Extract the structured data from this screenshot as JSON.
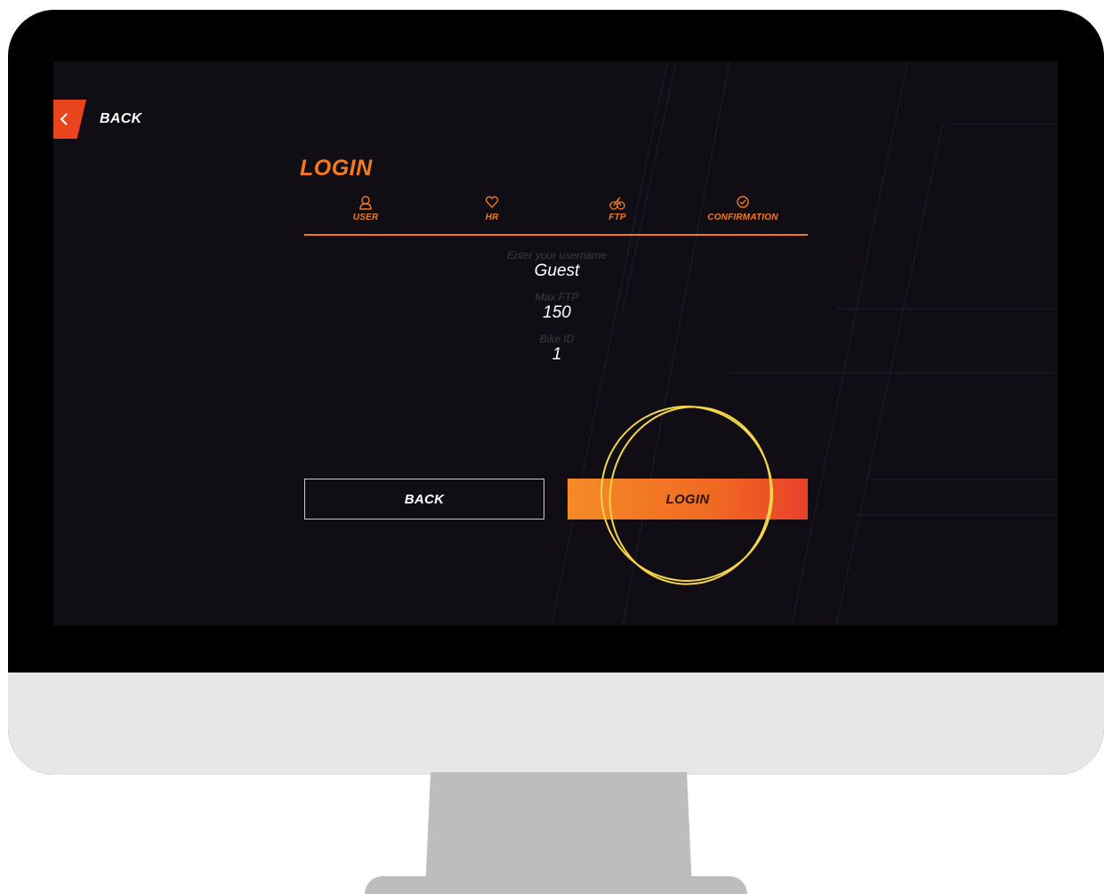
{
  "top_nav": {
    "back_label": "BACK"
  },
  "page_title": "LOGIN",
  "steps": [
    {
      "label": "USER",
      "icon": "user-icon"
    },
    {
      "label": "HR",
      "icon": "heart-icon"
    },
    {
      "label": "FTP",
      "icon": "bike-icon"
    },
    {
      "label": "CONFIRMATION",
      "icon": "check-circle-icon"
    }
  ],
  "form": {
    "username": {
      "placeholder": "Enter your username",
      "value": "Guest"
    },
    "max_ftp": {
      "placeholder": "Max FTP",
      "value": "150"
    },
    "bike_id": {
      "placeholder": "Bike ID",
      "value": "1"
    }
  },
  "actions": {
    "back_label": "BACK",
    "login_label": "LOGIN"
  },
  "colors": {
    "accent": "#f47a1f",
    "accent_red": "#e8451f",
    "screen_bg": "#100d14",
    "highlight_scribble": "#f5d54a"
  }
}
